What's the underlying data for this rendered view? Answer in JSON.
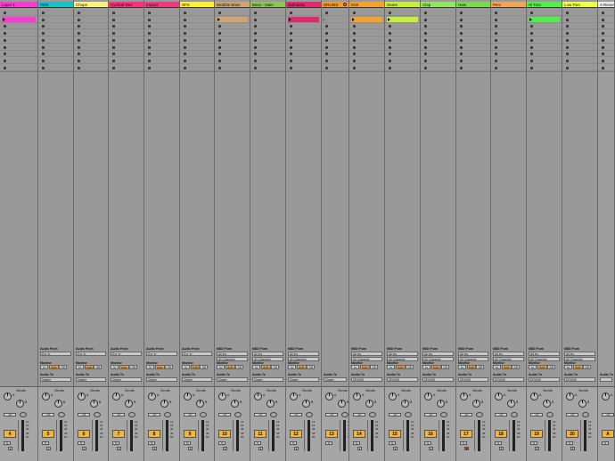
{
  "tracks": [
    {
      "name": "Layer 1",
      "color": "#ff39d4",
      "type": "midi",
      "from_label": "",
      "from": "",
      "channel": "",
      "monitor_label": "",
      "to_label": "",
      "to": "",
      "number": "",
      "clips": [
        "#ff39d4"
      ]
    },
    {
      "name": "VOX",
      "color": "#19c0c8",
      "type": "audio",
      "from_label": "Audio From",
      "from": "Ext. In",
      "channel": "",
      "monitor_label": "Monitor",
      "to_label": "Audio To",
      "to": "Master",
      "number": "5",
      "clips": []
    },
    {
      "name": "Chops",
      "color": "#fff27c",
      "type": "audio",
      "from_label": "Audio From",
      "from": "Ext. In",
      "channel": "",
      "monitor_label": "Monitor",
      "to_label": "Audio To",
      "to": "Master",
      "number": "6",
      "clips": []
    },
    {
      "name": "Cymbal Rev",
      "color": "#ff2f7a",
      "type": "audio",
      "from_label": "Audio From",
      "from": "Ext. In",
      "channel": "",
      "monitor_label": "Monitor",
      "to_label": "Audio To",
      "to": "Master",
      "number": "7",
      "clips": []
    },
    {
      "name": "Impact",
      "color": "#f0397c",
      "type": "audio",
      "from_label": "Audio From",
      "from": "Ext. In",
      "channel": "",
      "monitor_label": "Monitor",
      "to_label": "Audio To",
      "to": "Master",
      "number": "8",
      "clips": []
    },
    {
      "name": "SFX",
      "color": "#fff034",
      "type": "audio",
      "from_label": "Audio From",
      "from": "Ext. In",
      "channel": "",
      "monitor_label": "Monitor",
      "to_label": "Audio To",
      "to": "Master",
      "number": "9",
      "clips": []
    },
    {
      "name": "Wobble Bass",
      "color": "#d1a36e",
      "type": "midi",
      "from_label": "MIDI From",
      "from": "All Ins",
      "channel": "All Channels",
      "monitor_label": "Monitor",
      "to_label": "Audio To",
      "to": "Master",
      "number": "10",
      "clips": [
        "#d1a36e"
      ]
    },
    {
      "name": "Bass - Main",
      "color": "#8dc653",
      "type": "midi",
      "from_label": "MIDI From",
      "from": "All Ins",
      "channel": "All Channels",
      "monitor_label": "Monitor",
      "to_label": "Audio To",
      "to": "Master",
      "number": "11",
      "clips": []
    },
    {
      "name": "Sub Bass",
      "color": "#e2286a",
      "type": "midi",
      "from_label": "MIDI From",
      "from": "All Ins",
      "channel": "All Channels",
      "monitor_label": "Monitor",
      "to_label": "Audio To",
      "to": "Master",
      "number": "12",
      "clips": [
        "#e2286a"
      ]
    },
    {
      "name": "DRUMS",
      "color": "#f59a2a",
      "type": "group",
      "from_label": "",
      "from": "",
      "channel": "",
      "monitor_label": "",
      "to_label": "Audio To",
      "to": "Master",
      "number": "13",
      "clips": []
    },
    {
      "name": "Kick",
      "color": "#f5a12a",
      "type": "midi",
      "from_label": "MIDI From",
      "from": "All Ins",
      "channel": "All Channels",
      "monitor_label": "Monitor",
      "to_label": "Audio To",
      "to": "DRUMS",
      "number": "14",
      "clips": [
        "#f5a12a"
      ]
    },
    {
      "name": "Snare",
      "color": "#c7f03a",
      "type": "midi",
      "from_label": "MIDI From",
      "from": "All Ins",
      "channel": "All Channels",
      "monitor_label": "Monitor",
      "to_label": "Audio To",
      "to": "DRUMS",
      "number": "15",
      "clips": [
        "#c7f03a"
      ]
    },
    {
      "name": "Clap",
      "color": "#8ee85a",
      "type": "midi",
      "from_label": "MIDI From",
      "from": "All Ins",
      "channel": "All Channels",
      "monitor_label": "Monitor",
      "to_label": "Audio To",
      "to": "DRUMS",
      "number": "16",
      "clips": []
    },
    {
      "name": "Hats",
      "color": "#7bdc4a",
      "type": "midi",
      "from_label": "MIDI From",
      "from": "All Ins",
      "channel": "All Channels",
      "monitor_label": "Monitor",
      "to_label": "Audio To",
      "to": "DRUMS",
      "number": "17",
      "clips": []
    },
    {
      "name": "Perc",
      "color": "#f5a552",
      "type": "midi",
      "from_label": "MIDI From",
      "from": "All Ins",
      "channel": "All Channels",
      "monitor_label": "Monitor",
      "to_label": "Audio To",
      "to": "DRUMS",
      "number": "18",
      "clips": []
    },
    {
      "name": "Hi Tom",
      "color": "#4ff04a",
      "type": "midi",
      "from_label": "MIDI From",
      "from": "All Ins",
      "channel": "All Channels",
      "monitor_label": "Monitor",
      "to_label": "Audio To",
      "to": "DRUMS",
      "number": "19",
      "clips": [
        "#4ff04a"
      ]
    },
    {
      "name": "Low Tom",
      "color": "#f0ff4a",
      "type": "midi",
      "from_label": "MIDI From",
      "from": "All Ins",
      "channel": "All Channels",
      "monitor_label": "Monitor",
      "to_label": "Audio To",
      "to": "DRUMS",
      "number": "20",
      "clips": []
    },
    {
      "name": "A Reverb",
      "color": "#ececec",
      "type": "return",
      "from_label": "",
      "from": "",
      "channel": "",
      "monitor_label": "",
      "to_label": "Audio To",
      "to": "",
      "number": "A",
      "clips": []
    }
  ],
  "first_track_number": "4",
  "sends_label": "Sends",
  "send_letters": [
    "A",
    "B"
  ],
  "volume_readout": "-inf",
  "meter_scale": [
    "12",
    "24",
    "36",
    "48",
    "60"
  ],
  "monitor_buttons": [
    "In",
    "Auto",
    "Off"
  ],
  "armed_track_index": 13
}
